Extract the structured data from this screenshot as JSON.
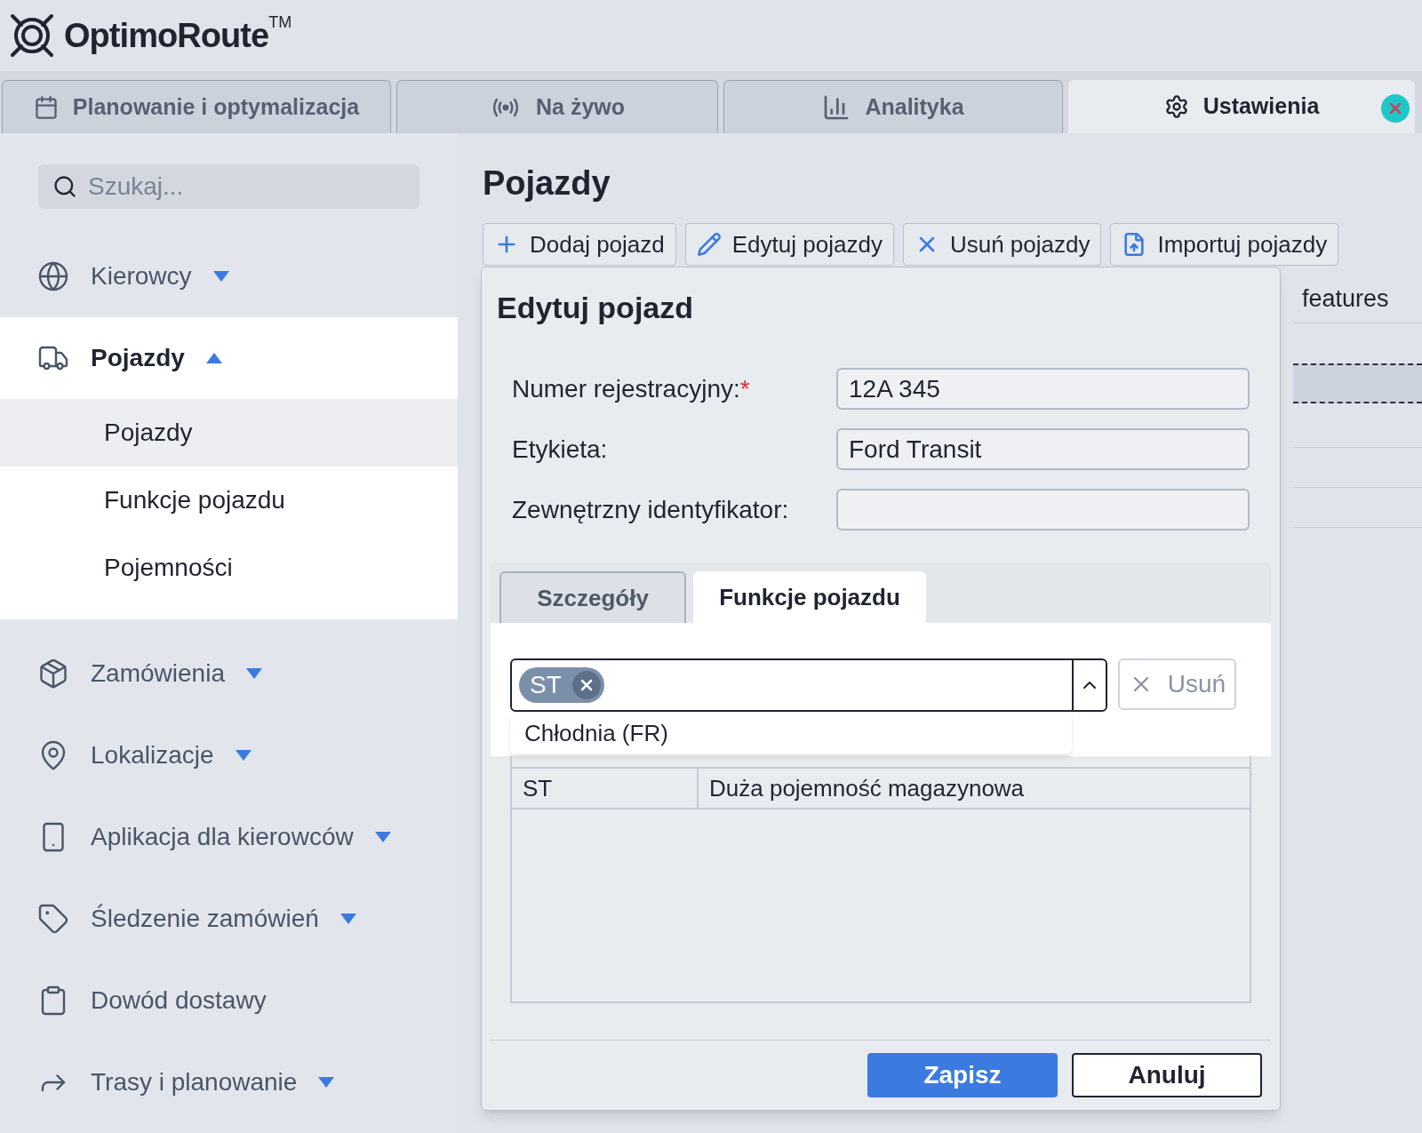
{
  "brand": {
    "name": "OptimoRoute",
    "trademark": "TM"
  },
  "tabs": [
    {
      "label": "Planowanie i optymalizacja",
      "kind": "calendar",
      "selected": false
    },
    {
      "label": "Na żywo",
      "kind": "live",
      "selected": false
    },
    {
      "label": "Analityka",
      "kind": "chart",
      "selected": false
    },
    {
      "label": "Ustawienia",
      "kind": "settings",
      "selected": true
    }
  ],
  "sidebar": {
    "search": {
      "placeholder": "Szukaj..."
    },
    "items": [
      {
        "label": "Kierowcy",
        "kind": "globe",
        "expanded": false
      },
      {
        "label": "Pojazdy",
        "kind": "truck",
        "expanded": true,
        "children": [
          {
            "label": "Pojazdy",
            "selected": true
          },
          {
            "label": "Funkcje pojazdu",
            "selected": false
          },
          {
            "label": "Pojemności",
            "selected": false
          }
        ]
      },
      {
        "label": "Zamówienia",
        "kind": "package",
        "expanded": false
      },
      {
        "label": "Lokalizacje",
        "kind": "pin",
        "expanded": false
      },
      {
        "label": "Aplikacja dla kierowców",
        "kind": "phone",
        "expanded": false
      },
      {
        "label": "Śledzenie zamówień",
        "kind": "tag",
        "expanded": false
      },
      {
        "label": "Dowód dostawy",
        "kind": "clipboard"
      },
      {
        "label": "Trasy i planowanie",
        "kind": "route",
        "expanded": false
      }
    ]
  },
  "page": {
    "title": "Pojazdy",
    "toolbar": [
      {
        "label": "Dodaj pojazd",
        "kind": "add"
      },
      {
        "label": "Edytuj pojazdy",
        "kind": "edit"
      },
      {
        "label": "Usuń pojazdy",
        "kind": "delete"
      },
      {
        "label": "Importuj pojazdy",
        "kind": "import"
      }
    ],
    "background_column": "features"
  },
  "dialog": {
    "title": "Edytuj pojazd",
    "fields": [
      {
        "label": "Numer rejestracyjny:",
        "marker": "*",
        "value": "12A 345"
      },
      {
        "label": "Etykieta:",
        "value": "Ford Transit"
      },
      {
        "label": "Zewnętrzny identyfikator:"
      }
    ],
    "tabs": [
      {
        "label": "Szczegóły",
        "selected": false
      },
      {
        "label": "Funkcje pojazdu",
        "selected": true
      }
    ],
    "select": {
      "tags": [
        "ST"
      ],
      "expanded": true,
      "options": [
        "Chłodnia (FR)"
      ]
    },
    "remove_button": {
      "label": "Usuń",
      "disabled": true
    },
    "table": {
      "rows": [
        [
          "ST",
          "Duża pojemność magazynowa"
        ]
      ]
    },
    "buttons": [
      {
        "label": "Zapisz",
        "kind": "primary"
      },
      {
        "label": "Anuluj",
        "kind": "secondary"
      }
    ]
  }
}
